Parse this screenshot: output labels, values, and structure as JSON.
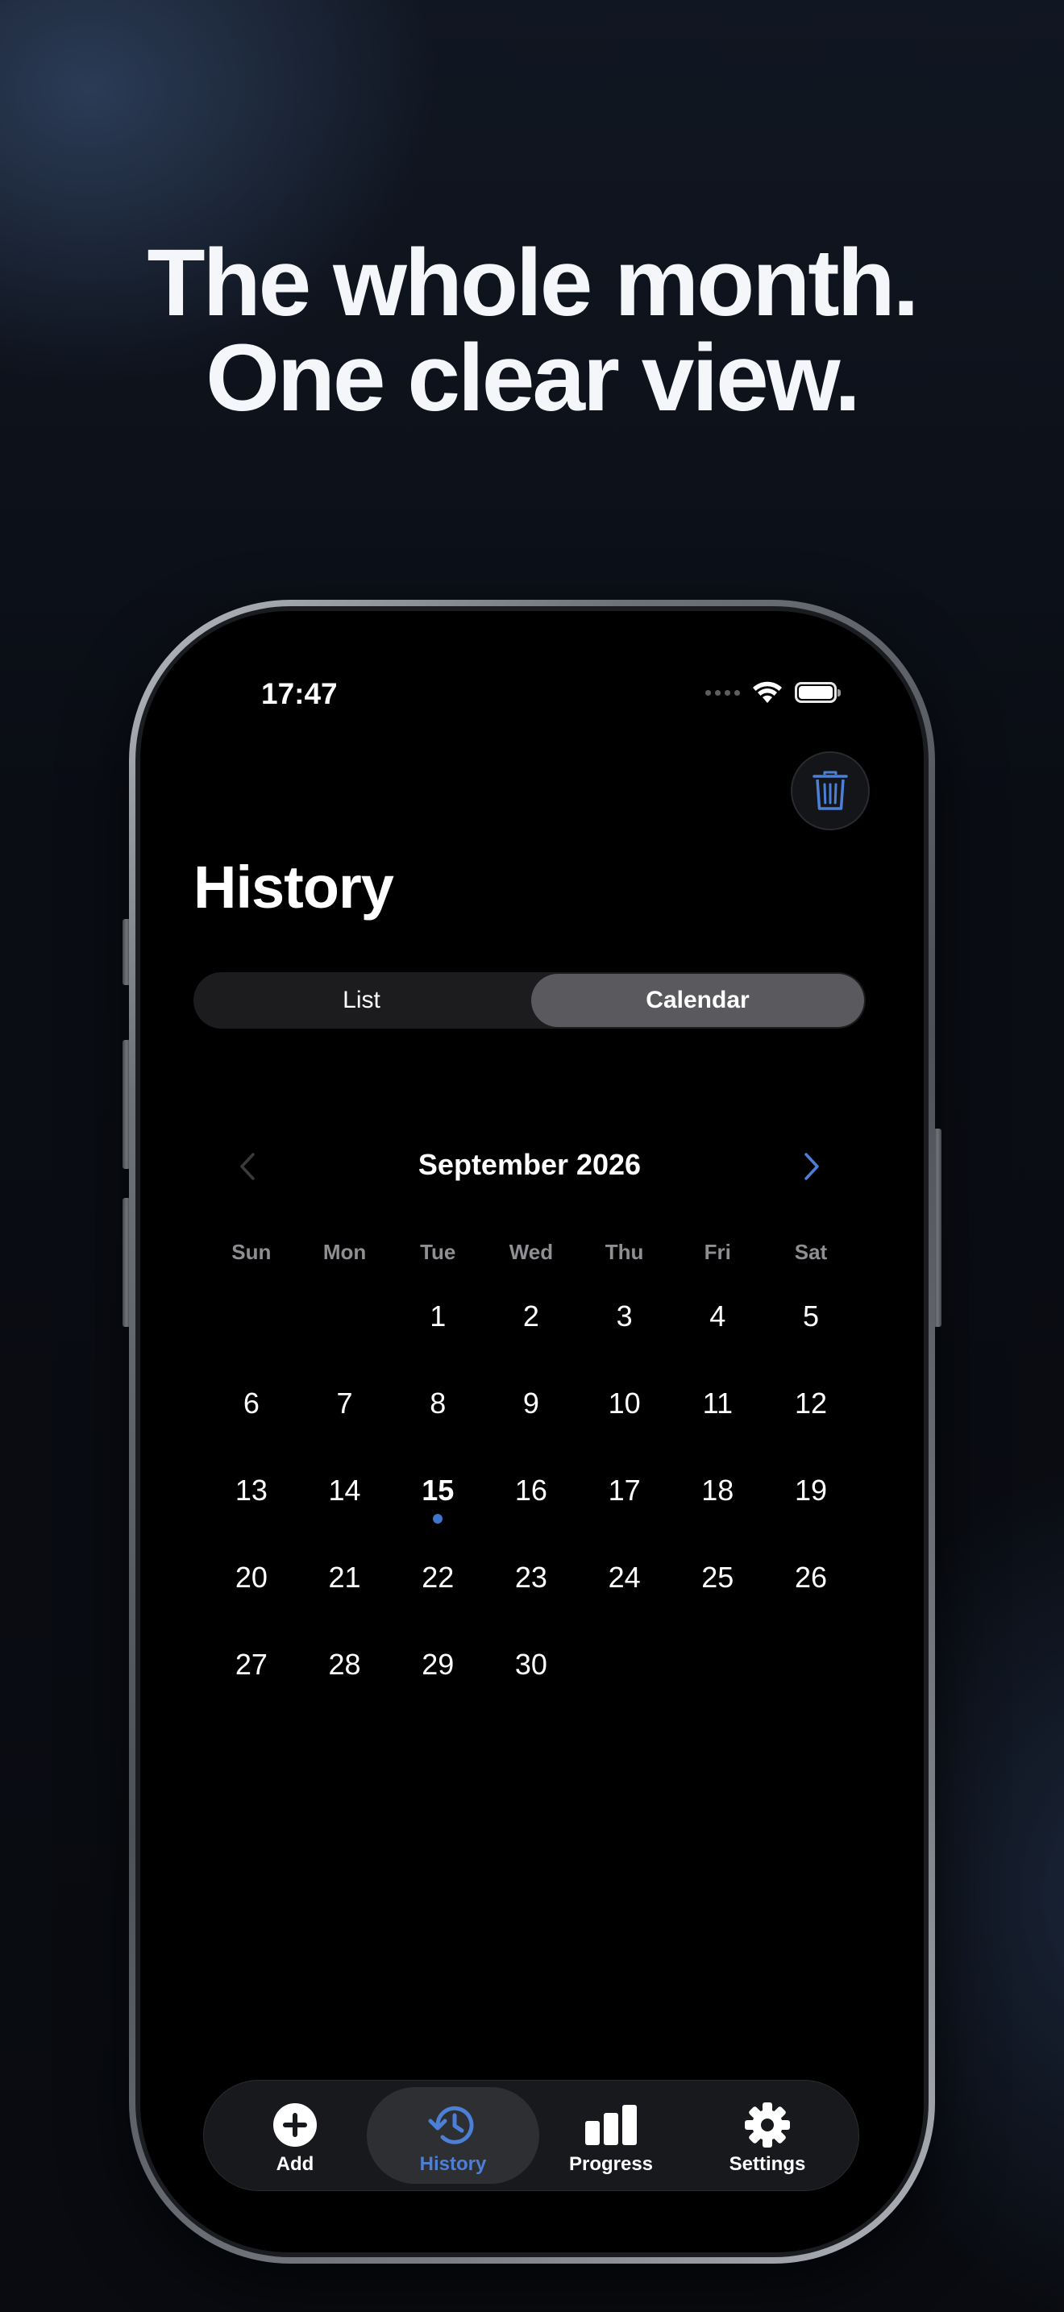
{
  "headline": {
    "line1": "The whole month.",
    "line2": "One clear view."
  },
  "status_bar": {
    "time": "17:47"
  },
  "screen": {
    "title": "History",
    "segments": [
      {
        "label": "List",
        "active": false
      },
      {
        "label": "Calendar",
        "active": true
      }
    ]
  },
  "calendar": {
    "month_label": "September 2026",
    "weekdays": [
      "Sun",
      "Mon",
      "Tue",
      "Wed",
      "Thu",
      "Fri",
      "Sat"
    ],
    "weeks": [
      [
        "",
        "",
        "1",
        "2",
        "3",
        "4",
        "5"
      ],
      [
        "6",
        "7",
        "8",
        "9",
        "10",
        "11",
        "12"
      ],
      [
        "13",
        "14",
        "15",
        "16",
        "17",
        "18",
        "19"
      ],
      [
        "20",
        "21",
        "22",
        "23",
        "24",
        "25",
        "26"
      ],
      [
        "27",
        "28",
        "29",
        "30",
        "",
        "",
        ""
      ]
    ],
    "today": "15",
    "days_with_entries": [
      "15"
    ]
  },
  "tabbar": {
    "items": [
      {
        "label": "Add",
        "icon": "plus-circle-icon",
        "active": false
      },
      {
        "label": "History",
        "icon": "history-clock-icon",
        "active": true
      },
      {
        "label": "Progress",
        "icon": "bar-chart-icon",
        "active": false
      },
      {
        "label": "Settings",
        "icon": "gear-icon",
        "active": false
      }
    ]
  },
  "colors": {
    "accent": "#4c7fd6",
    "background": "#000000",
    "segment_active": "#5a5a5e"
  }
}
